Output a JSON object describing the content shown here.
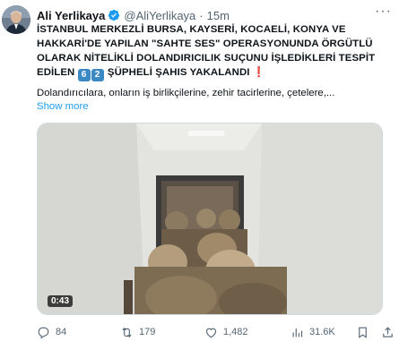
{
  "author": {
    "name": "Ali Yerlikaya",
    "handle": "@AliYerlikaya",
    "separator": "·",
    "time": "15m",
    "verified": true
  },
  "tweet": {
    "lines": [
      "İSTANBUL MERKEZLİ BURSA, KAYSERİ, KOCAELİ, KONYA VE",
      "HAKKARİ'DE YAPILAN \"SAHTE SES\" OPERASYONUNDA ÖRGÜTLÜ",
      "OLARAK NİTELİKLİ DOLANDIRICILIK SUÇUNU İŞLEDİKLERİ TESPİT"
    ],
    "last_line_prefix": "EDİLEN",
    "keycap_1": "6",
    "keycap_2": "2",
    "last_line_suffix": "ŞÜPHELİ ŞAHIS YAKALANDI",
    "exclamation": "❗",
    "snippet": "Dolandırıcılara, onların iş birlikçilerine, zehir tacirlerine, çetelere,...",
    "show_more": "Show more"
  },
  "media": {
    "duration": "0:43"
  },
  "actions": {
    "replies": "84",
    "retweets": "179",
    "likes": "1,482",
    "views": "31.6K"
  },
  "colors": {
    "link": "#1d9bf0",
    "verified": "#1d9bf0",
    "muted": "#536471",
    "keycap": "#3b88c3"
  }
}
